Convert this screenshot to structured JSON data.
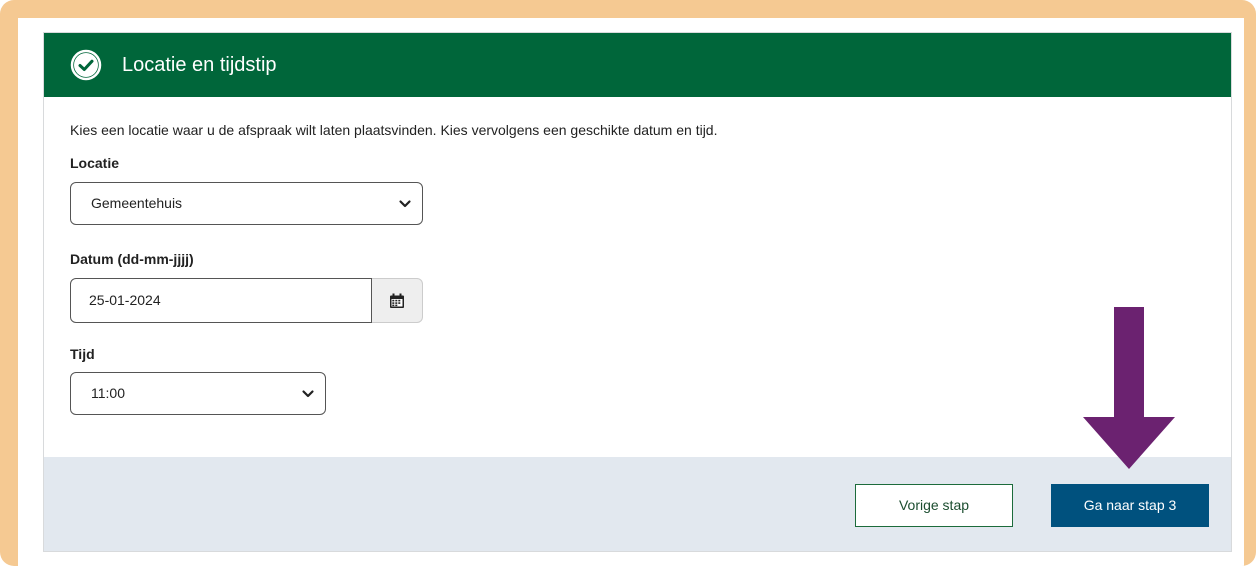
{
  "section": {
    "title": "Locatie en tijdstip",
    "intro": "Kies een locatie waar u de afspraak wilt laten plaatsvinden. Kies vervolgens een geschikte datum en tijd."
  },
  "locatie": {
    "label": "Locatie",
    "selected": "Gemeentehuis"
  },
  "datum": {
    "label": "Datum (dd-mm-jjjj)",
    "value": "25-01-2024"
  },
  "tijd": {
    "label": "Tijd",
    "selected": "11:00"
  },
  "footer": {
    "prev_label": "Vorige stap",
    "next_label": "Ga naar stap 3"
  },
  "colors": {
    "header_green": "#00663a",
    "primary_blue": "#00517e",
    "annotation_arrow": "#6b2270",
    "frame_border": "#f5c992"
  },
  "icons": {
    "header": "check-circle-icon",
    "dropdown": "chevron-down-icon",
    "calendar": "calendar-icon",
    "annotation": "arrow-down-icon"
  }
}
